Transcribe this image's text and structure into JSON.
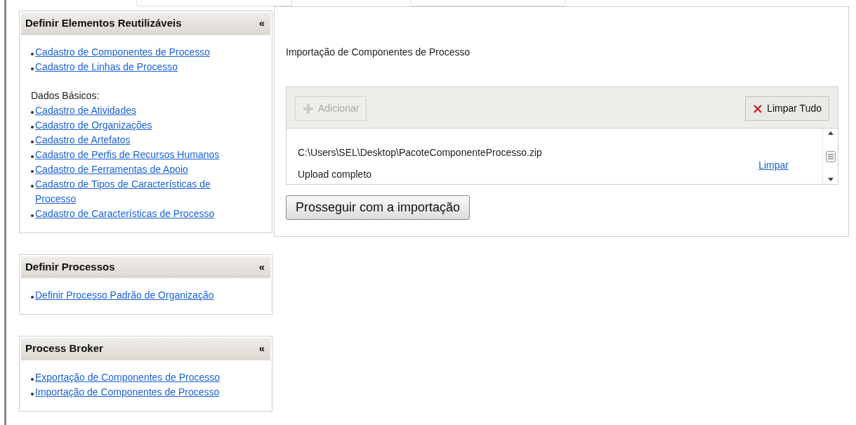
{
  "sidebar": [
    {
      "title": "Definir Elementos Reutilizáveis",
      "collapse": "«",
      "items": [
        {
          "kind": "link",
          "text": "Cadastro de Componentes de Processo"
        },
        {
          "kind": "link",
          "text": "Cadastro de Linhas de Processo"
        },
        {
          "kind": "label",
          "text": "Dados Básicos:"
        },
        {
          "kind": "link",
          "text": "Cadastro de Atividades"
        },
        {
          "kind": "link",
          "text": "Cadastro de Organizações"
        },
        {
          "kind": "link",
          "text": "Cadastro de Artefatos"
        },
        {
          "kind": "link",
          "text": "Cadastro de Perfis de Recursos Humanos"
        },
        {
          "kind": "link",
          "text": "Cadastro de Ferramentas de Apoio"
        },
        {
          "kind": "link",
          "text": "Cadastro de Tipos de Características de Processo"
        },
        {
          "kind": "link",
          "text": "Cadastro de Características de Processo"
        }
      ]
    },
    {
      "title": "Definir Processos",
      "collapse": "«",
      "items": [
        {
          "kind": "link",
          "text": "Definir Processo Padrão de Organização"
        }
      ]
    },
    {
      "title": "Process Broker",
      "collapse": "«",
      "items": [
        {
          "kind": "link",
          "text": "Exportação de Componentes de Processo"
        },
        {
          "kind": "link",
          "text": "Importação de Componentes de Processo"
        }
      ]
    }
  ],
  "main": {
    "title": "Importação de Componentes de Processo",
    "uploader": {
      "add_button": {
        "label": "Adicionar",
        "disabled": true
      },
      "clear_all_button": {
        "label": "Limpar Tudo",
        "disabled": false
      },
      "files": [
        {
          "path": "C:\\Users\\SEL\\Desktop\\PacoteComponenteProcesso.zip",
          "status": "Upload completo",
          "action": "Limpar"
        }
      ]
    },
    "submit_button": "Prosseguir com a importação"
  }
}
